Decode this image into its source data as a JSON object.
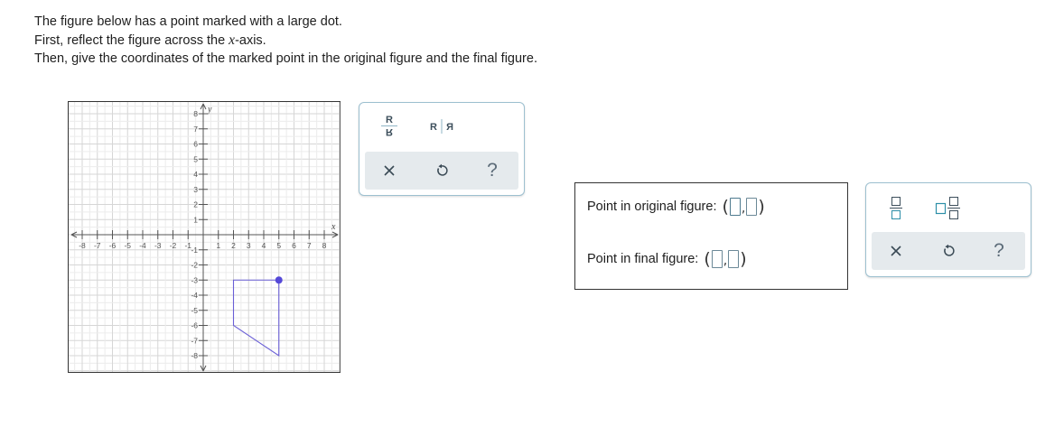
{
  "instructions": {
    "line1": "The figure below has a point marked with a large dot.",
    "line2_prefix": "First, reflect the figure across the ",
    "line2_var": "x",
    "line2_suffix": "-axis.",
    "line3": "Then, give the coordinates of the marked point in the original figure and the final figure."
  },
  "graph": {
    "x_axis_label": "x",
    "y_axis_label": "y",
    "x_tick_labels": [
      "-8",
      "-7",
      "-6",
      "-5",
      "-4",
      "-3",
      "-2",
      "-1",
      "1",
      "2",
      "3",
      "4",
      "5",
      "6",
      "7",
      "8"
    ],
    "y_tick_labels": [
      "8",
      "7",
      "6",
      "5",
      "4",
      "3",
      "2",
      "1",
      "-1",
      "-2",
      "-3",
      "-4",
      "-5",
      "-6",
      "-7",
      "-8"
    ],
    "x_range": [
      -8,
      8
    ],
    "y_range": [
      -8,
      8
    ],
    "grid": true,
    "figure_vertices": [
      [
        2,
        -3
      ],
      [
        5,
        -3
      ],
      [
        5,
        -8
      ],
      [
        2,
        -6
      ]
    ],
    "marked_point": [
      5,
      -3
    ],
    "figure_color": "#6a5fd6",
    "point_color": "#5549d8"
  },
  "tools": {
    "reflect_vertical": "R",
    "reflect_vertical_mirror": "R",
    "reflect_horizontal": "R",
    "reflect_horizontal_mirror": "R",
    "clear_icon": "close-icon",
    "undo_icon": "undo-icon",
    "help_label": "?"
  },
  "answers": {
    "original_label": "Point in original figure:",
    "final_label": "Point in final figure:",
    "open_paren": "(",
    "comma": ",",
    "close_paren": ")",
    "original_x": "",
    "original_y": "",
    "final_x": "",
    "final_y": ""
  },
  "math_tools": {
    "fraction_icon": "fraction-icon",
    "mixed_number_icon": "mixed-number-icon",
    "clear_icon": "close-icon",
    "undo_icon": "undo-icon",
    "help_label": "?"
  },
  "colors": {
    "panel_border": "#9dc0d0",
    "toolbar_bg": "#e5eaed",
    "accent_teal": "#2d8fa8"
  }
}
